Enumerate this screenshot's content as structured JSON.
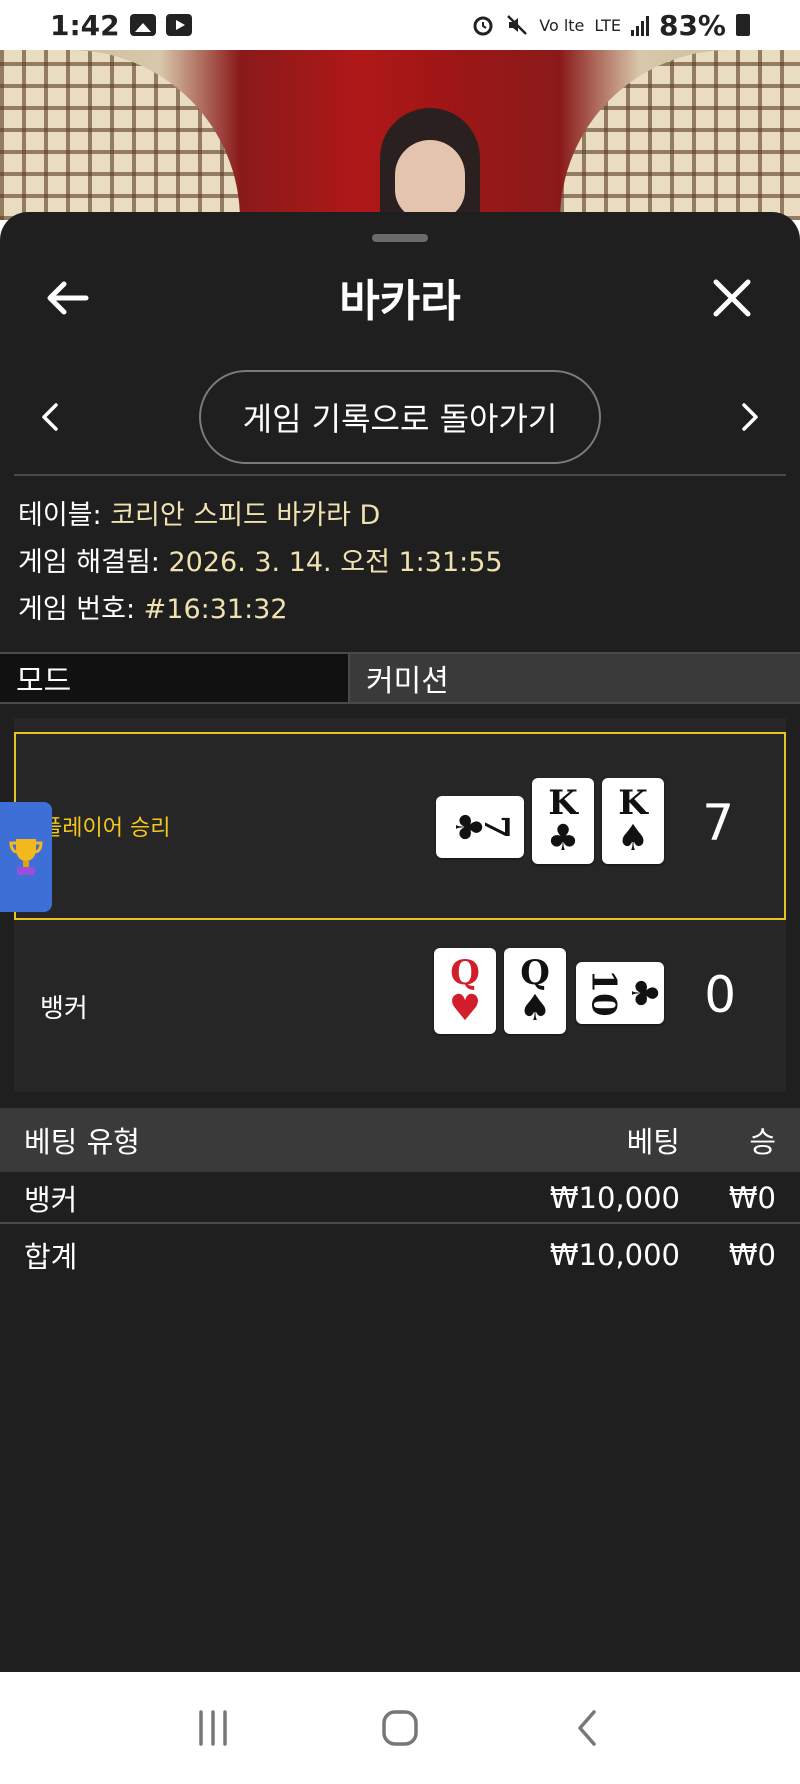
{
  "status_bar": {
    "time": "1:42",
    "network": "LTE",
    "volte": "Vo lte",
    "battery": "83%"
  },
  "header": {
    "title": "바카라",
    "back_icon": "arrow-left-icon",
    "close_icon": "close-icon"
  },
  "history_nav": {
    "button_label": "게임 기록으로 돌아가기"
  },
  "game_info": {
    "table_label": "테이블:",
    "table_value": "코리안 스피드 바카라 D",
    "resolved_label": "게임 해결됨:",
    "resolved_value": "2026. 3. 14. 오전 1:31:55",
    "number_label": "게임 번호:",
    "number_value": "#16:31:32"
  },
  "tabs": [
    {
      "label": "모드"
    },
    {
      "label": "커미션"
    }
  ],
  "result": {
    "player": {
      "label": "플레이어 승리",
      "score": "7",
      "cards": [
        {
          "rank": "7",
          "suit": "♣",
          "color": "#111111"
        },
        {
          "rank": "K",
          "suit": "♣",
          "color": "#111111"
        },
        {
          "rank": "K",
          "suit": "♠",
          "color": "#111111"
        }
      ]
    },
    "banker": {
      "label": "뱅커",
      "score": "0",
      "cards": [
        {
          "rank": "Q",
          "suit": "♥",
          "color": "#d21e2b"
        },
        {
          "rank": "Q",
          "suit": "♠",
          "color": "#111111"
        },
        {
          "rank": "10",
          "suit": "♣",
          "color": "#111111"
        }
      ]
    }
  },
  "bets": {
    "header": {
      "type": "베팅 유형",
      "bet": "베팅",
      "win": "승"
    },
    "rows": [
      {
        "type": "뱅커",
        "bet": "₩10,000",
        "win": "₩0"
      }
    ],
    "total": {
      "type": "합계",
      "bet": "₩10,000",
      "win": "₩0"
    }
  },
  "colors": {
    "accent_gold": "#e6c420",
    "sheet_bg": "#1f1f1f",
    "info_value": "#f0e2b0",
    "trophy_tab": "#3d6fd6"
  }
}
